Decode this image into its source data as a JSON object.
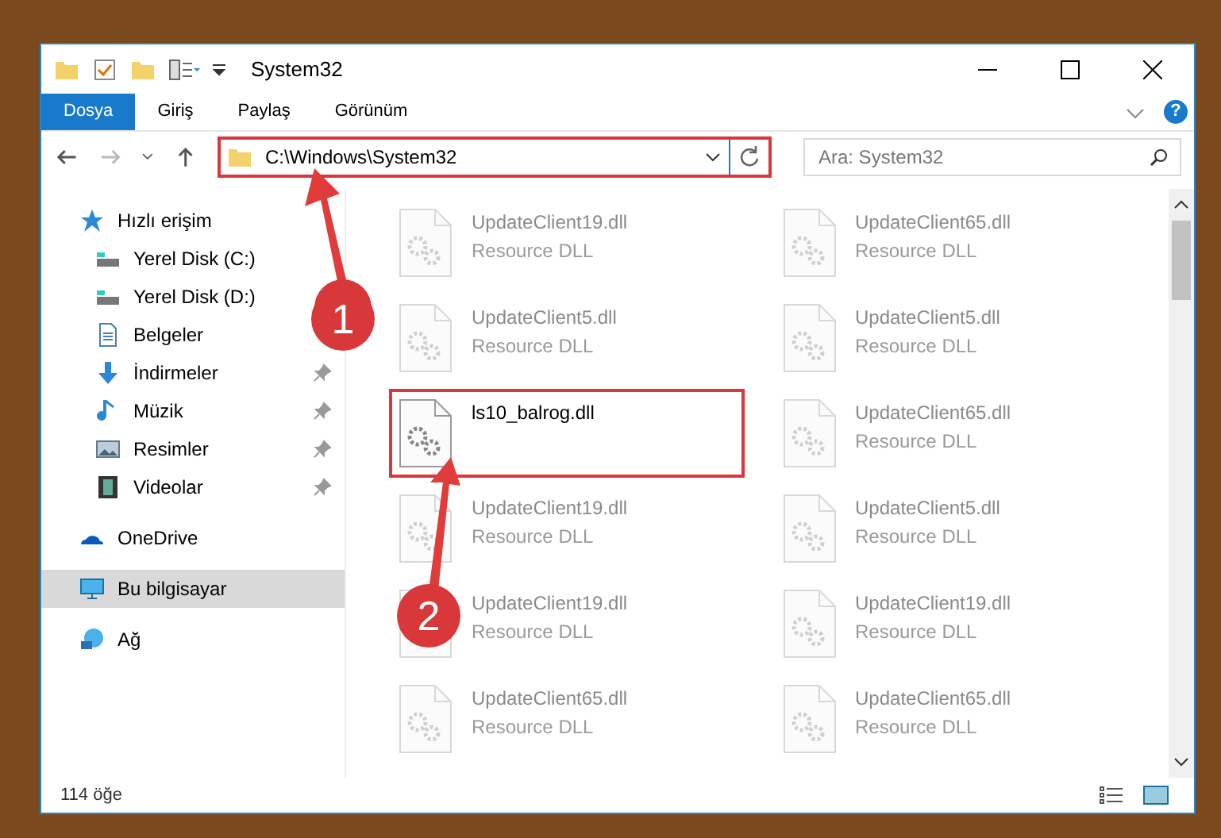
{
  "window": {
    "title": "System32"
  },
  "ribbon_tabs": [
    {
      "label": "Dosya",
      "selected": true
    },
    {
      "label": "Giriş",
      "selected": false
    },
    {
      "label": "Paylaş",
      "selected": false
    },
    {
      "label": "Görünüm",
      "selected": false
    }
  ],
  "help": "?",
  "address": {
    "path": "C:\\Windows\\System32",
    "highlighted": true
  },
  "search": {
    "placeholder": "Ara: System32"
  },
  "sidebar": {
    "items": [
      {
        "label": "Hızlı erişim",
        "kind": "star",
        "selected": false,
        "children": [
          {
            "label": "Yerel Disk (C:)",
            "kind": "disk",
            "pinned": false,
            "selected": false
          },
          {
            "label": "Yerel Disk (D:)",
            "kind": "disk",
            "pinned": false,
            "selected": false
          },
          {
            "label": "Belgeler",
            "kind": "doc",
            "pinned": false,
            "selected": false
          },
          {
            "label": "İndirmeler",
            "kind": "download",
            "pinned": true,
            "selected": false
          },
          {
            "label": "Müzik",
            "kind": "music",
            "pinned": true,
            "selected": false
          },
          {
            "label": "Resimler",
            "kind": "picture",
            "pinned": true,
            "selected": false
          },
          {
            "label": "Videolar",
            "kind": "video",
            "pinned": true,
            "selected": false
          }
        ]
      },
      {
        "label": "OneDrive",
        "kind": "cloud",
        "selected": false
      },
      {
        "label": "Bu bilgisayar",
        "kind": "pc",
        "selected": true
      },
      {
        "label": "Ağ",
        "kind": "network",
        "selected": false
      }
    ]
  },
  "files": [
    {
      "name": "UpdateClient19.dll",
      "type": "Resource DLL",
      "faded": true,
      "highlighted": false
    },
    {
      "name": "UpdateClient65.dll",
      "type": "Resource DLL",
      "faded": true,
      "highlighted": false
    },
    {
      "name": "UpdateClient5.dll",
      "type": "Resource DLL",
      "faded": true,
      "highlighted": false
    },
    {
      "name": "UpdateClient5.dll",
      "type": "Resource DLL",
      "faded": true,
      "highlighted": false
    },
    {
      "name": "ls10_balrog.dll",
      "faded": false,
      "highlighted": true
    },
    {
      "name": "UpdateClient65.dll",
      "type": "Resource DLL",
      "faded": true,
      "highlighted": false
    },
    {
      "name": "UpdateClient19.dll",
      "type": "Resource DLL",
      "faded": true,
      "highlighted": false
    },
    {
      "name": "UpdateClient5.dll",
      "type": "Resource DLL",
      "faded": true,
      "highlighted": false
    },
    {
      "name": "UpdateClient19.dll",
      "type": "Resource DLL",
      "faded": true,
      "highlighted": false
    },
    {
      "name": "UpdateClient19.dll",
      "type": "Resource DLL",
      "faded": true,
      "highlighted": false
    },
    {
      "name": "UpdateClient65.dll",
      "type": "Resource DLL",
      "faded": true,
      "highlighted": false
    },
    {
      "name": "UpdateClient65.dll",
      "type": "Resource DLL",
      "faded": true,
      "highlighted": false
    }
  ],
  "status_bar": {
    "count": "114 öğe"
  },
  "callouts": [
    "1",
    "2"
  ]
}
